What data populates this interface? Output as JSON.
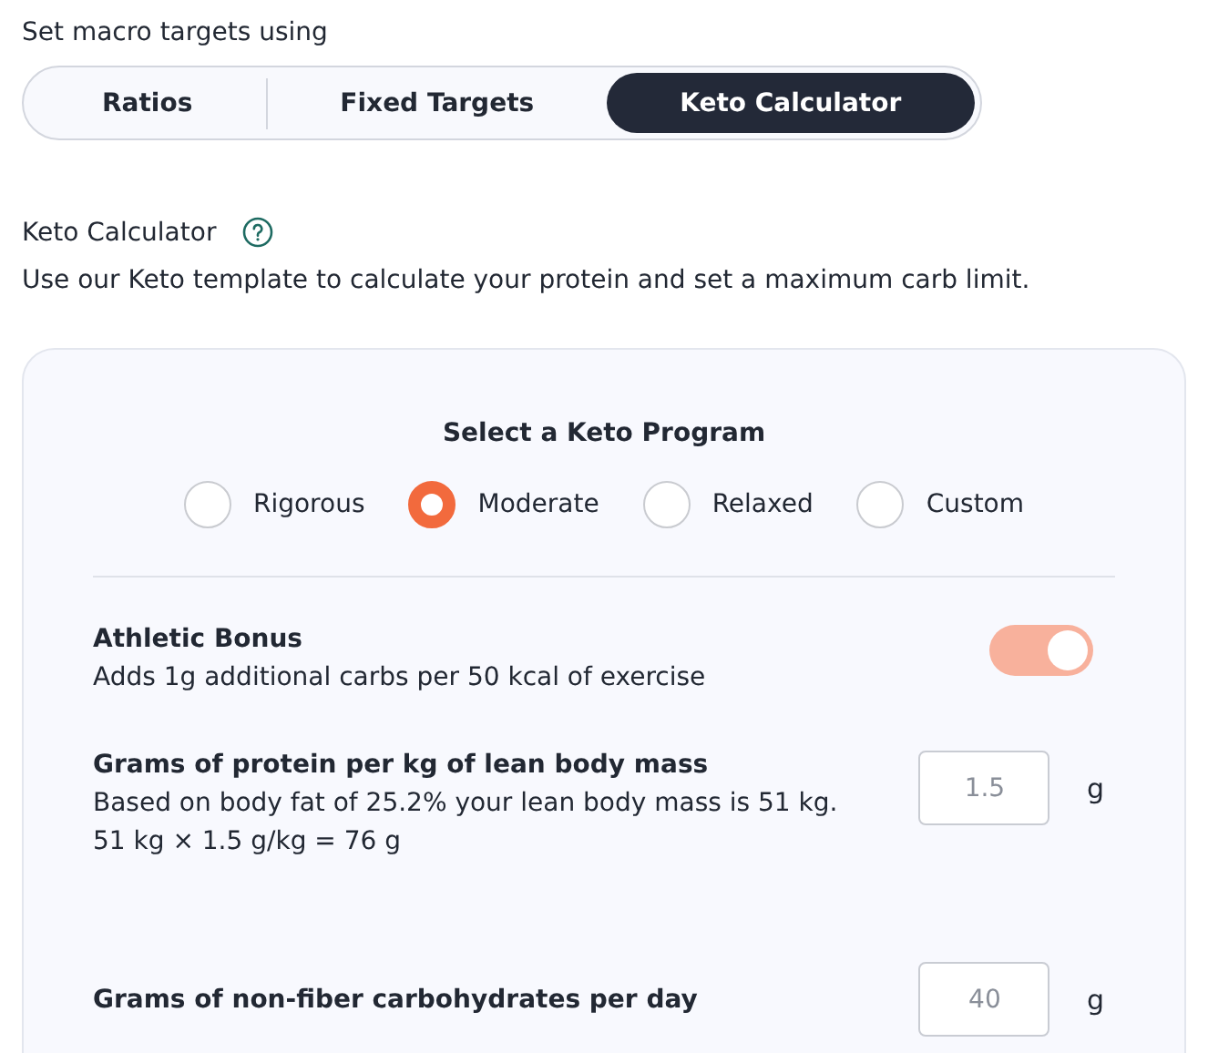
{
  "mode_label": "Set macro targets using",
  "tabs": [
    {
      "label": "Ratios",
      "selected": false
    },
    {
      "label": "Fixed Targets",
      "selected": false
    },
    {
      "label": "Keto Calculator",
      "selected": true
    }
  ],
  "section": {
    "title": "Keto Calculator",
    "description": "Use our Keto template to calculate your protein and set a maximum carb limit."
  },
  "program": {
    "title": "Select a Keto Program",
    "options": [
      {
        "label": "Rigorous",
        "selected": false
      },
      {
        "label": "Moderate",
        "selected": true
      },
      {
        "label": "Relaxed",
        "selected": false
      },
      {
        "label": "Custom",
        "selected": false
      }
    ]
  },
  "athletic_bonus": {
    "title": "Athletic Bonus",
    "description": "Adds 1g additional carbs per 50 kcal of exercise",
    "on": true
  },
  "fields": [
    {
      "title": "Grams of protein per kg of lean body mass",
      "lines": [
        "Based on body fat of 25.2% your lean body mass is 51 kg.",
        "51 kg × 1.5 g/kg = 76 g"
      ],
      "value": "1.5",
      "unit": "g"
    },
    {
      "title": "Grams of non-fiber carbohydrates per day",
      "value": "40",
      "unit": "g"
    }
  ]
}
